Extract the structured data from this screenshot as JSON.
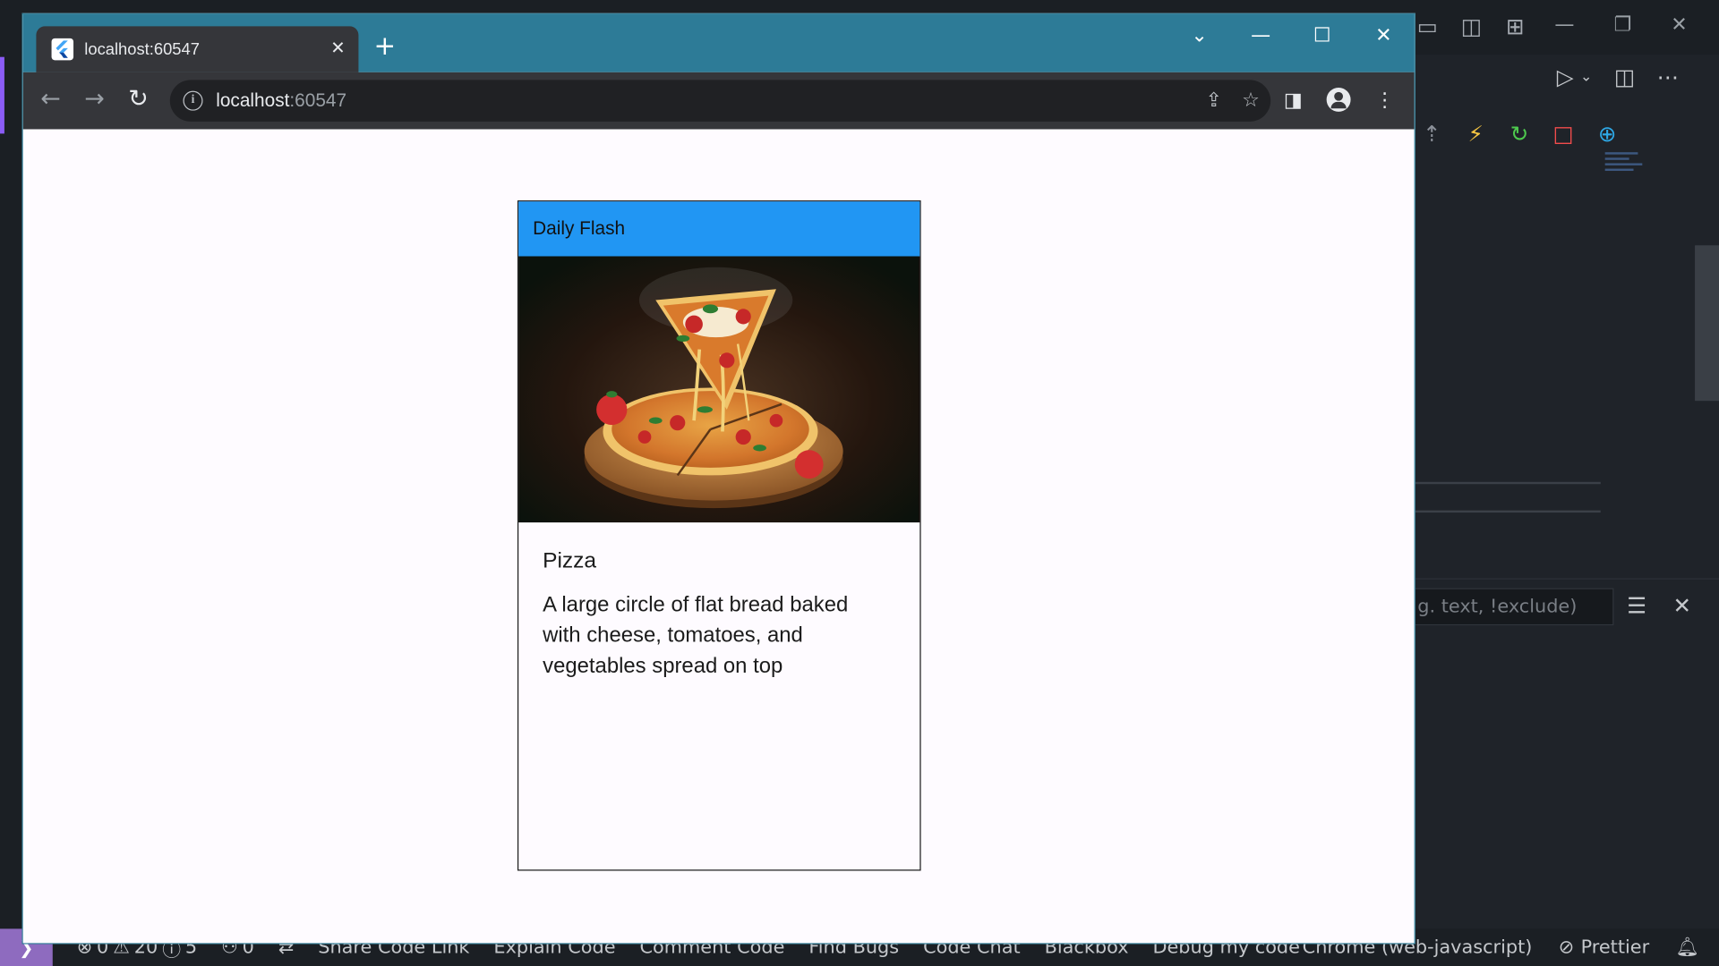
{
  "browser": {
    "tab_title": "localhost:60547",
    "url_host": "localhost",
    "url_port": ":60547"
  },
  "app": {
    "appbar_title": "Daily Flash",
    "food": {
      "name": "Pizza",
      "description": "A large circle of flat bread baked with cheese, tomatoes, and vegetables spread on top"
    }
  },
  "editor": {
    "filter_placeholder": "g. text, !exclude)"
  },
  "statusbar": {
    "problems_errors": "0",
    "problems_warnings": "20",
    "problems_info": "5",
    "ports": "0",
    "items": [
      "Share Code Link",
      "Explain Code",
      "Comment Code",
      "Find Bugs",
      "Code Chat",
      "Blackbox",
      "Debug my code"
    ],
    "device": "Chrome (web-javascript)",
    "prettier": "Prettier"
  },
  "colors": {
    "appbar": "#2196f3",
    "tabstrip": "#2d7b97",
    "toolbar": "#35363a",
    "statusbar_remote": "#8e6bbf"
  }
}
